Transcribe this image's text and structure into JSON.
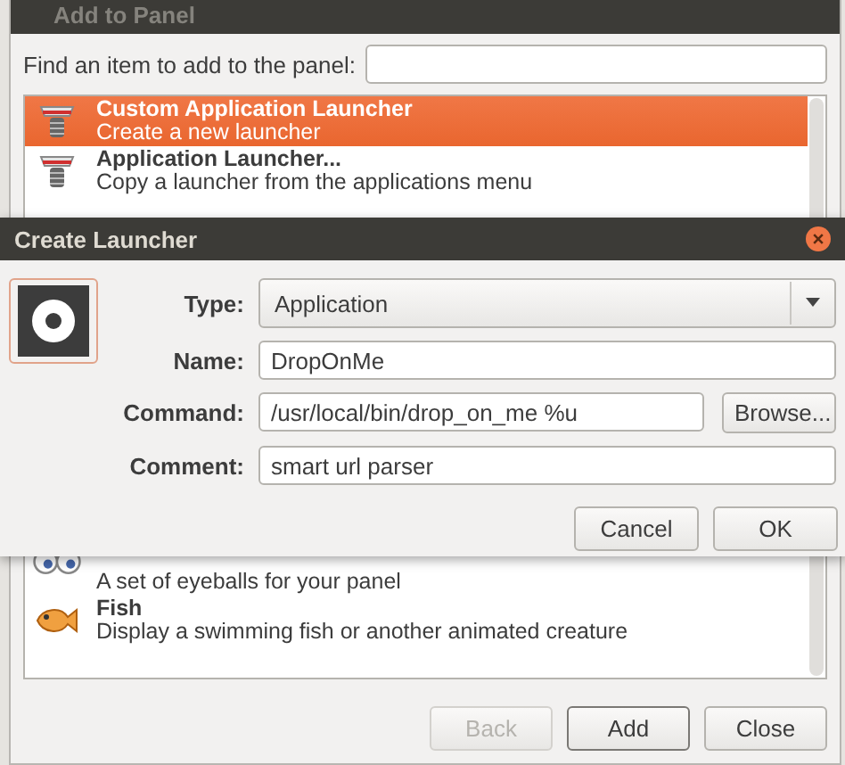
{
  "add_to_panel": {
    "title": "Add to Panel",
    "search_label": "Find an item to add to the panel:",
    "items": [
      {
        "name": "Custom Application Launcher",
        "description": "Create a new launcher",
        "selected": true
      },
      {
        "name": "Application Launcher...",
        "description": "Copy a launcher from the applications menu",
        "selected": false
      },
      {
        "description": "A set of eyeballs for your panel",
        "selected": false
      },
      {
        "name": "Fish",
        "description": "Display a swimming fish or another animated creature",
        "selected": false
      }
    ],
    "buttons": [
      {
        "label": "Back",
        "disabled": true
      },
      {
        "label": "Add",
        "disabled": false
      },
      {
        "label": "Close",
        "disabled": false
      }
    ]
  },
  "create_launcher": {
    "title": "Create Launcher",
    "type": {
      "label": "Type:",
      "value": "Application"
    },
    "name": {
      "label": "Name:",
      "value": "DropOnMe"
    },
    "command": {
      "label": "Command:",
      "value": "/usr/local/bin/drop_on_me %u",
      "browse": "Browse..."
    },
    "comment": {
      "label": "Comment:",
      "value": "smart url parser"
    },
    "buttons": [
      "Cancel",
      "OK"
    ]
  }
}
